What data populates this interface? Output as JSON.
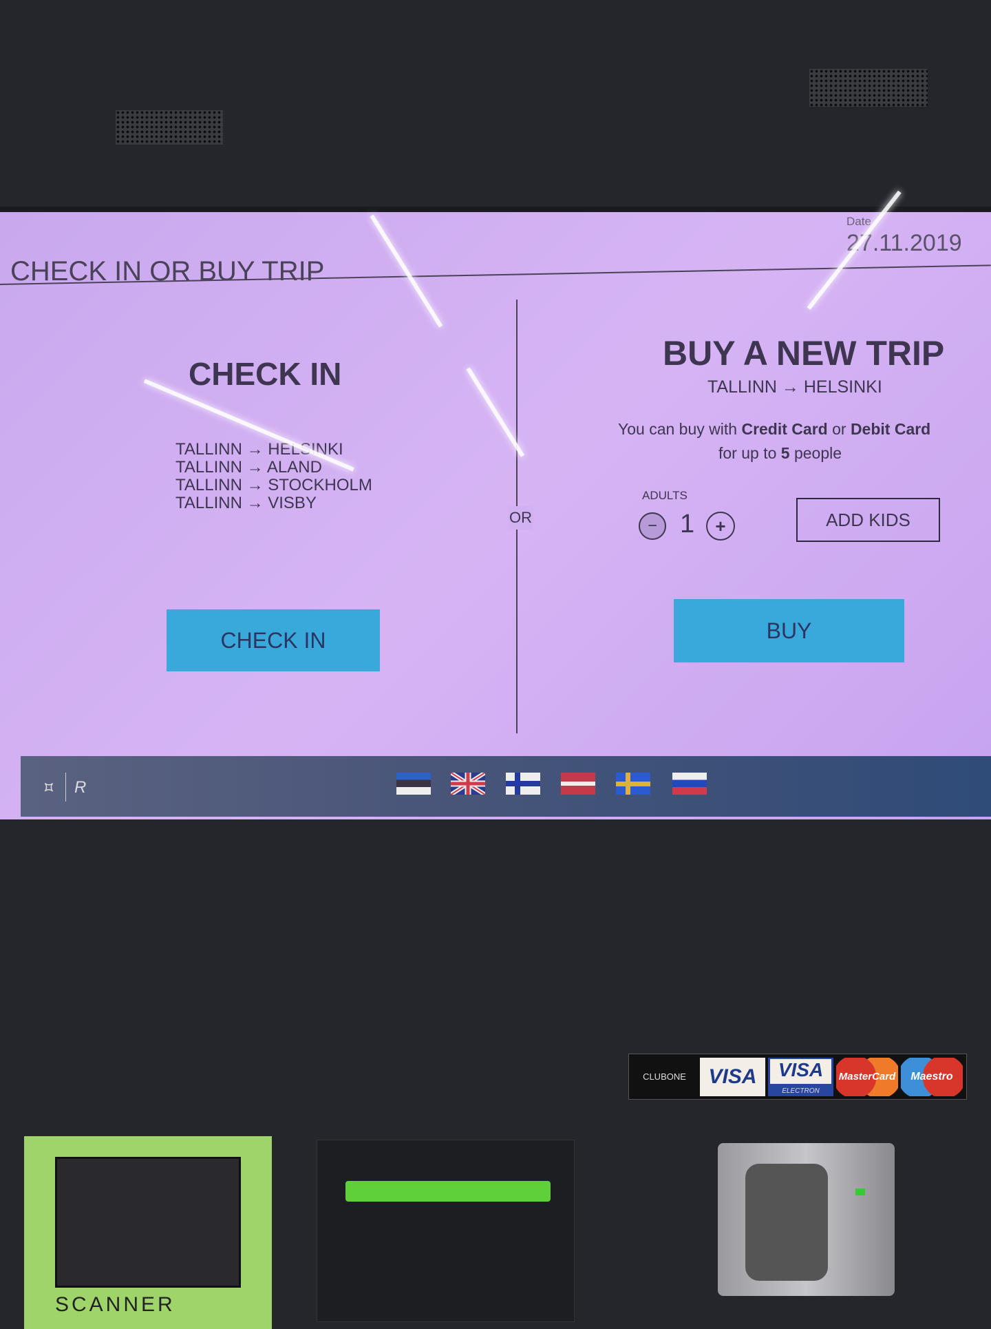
{
  "header": {
    "title": "CHECK IN OR BUY TRIP",
    "date_label": "Date",
    "date_value": "27.11.2019"
  },
  "check_in": {
    "heading": "CHECK IN",
    "routes": [
      "TALLINN → HELSINKI",
      "TALLINN → ALAND",
      "TALLINN → STOCKHOLM",
      "TALLINN → VISBY"
    ],
    "button": "CHECK IN"
  },
  "divider": {
    "label": "OR"
  },
  "buy": {
    "heading": "BUY A NEW TRIP",
    "route": "TALLINN → HELSINKI",
    "info_line1_pre": "You can buy with ",
    "info_cc": "Credit Card",
    "info_or": " or ",
    "info_dc": "Debit Card",
    "info_line2_pre": "for up to ",
    "info_count": "5",
    "info_line2_post": " people",
    "adults_label": "ADULTS",
    "adults_value": "1",
    "minus": "−",
    "plus": "+",
    "add_kids": "ADD KIDS",
    "button": "BUY"
  },
  "footer": {
    "languages": [
      "Estonian",
      "English",
      "Finnish",
      "Latvian",
      "Swedish",
      "Russian"
    ]
  },
  "kiosk": {
    "card_brands": [
      "CLUBONE",
      "VISA",
      "VISA",
      "ELECTRON",
      "MasterCard",
      "Maestro"
    ],
    "scanner_label": "SCANNER"
  }
}
